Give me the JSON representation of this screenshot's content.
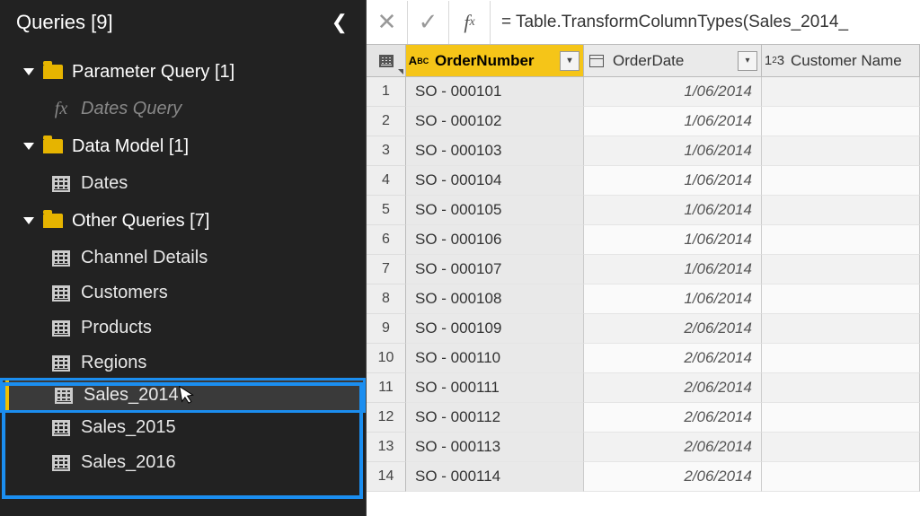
{
  "sidebar": {
    "title": "Queries [9]",
    "groups": [
      {
        "label": "Parameter Query [1]",
        "items": [
          {
            "label": "Dates Query",
            "icon": "fx",
            "dim": true
          }
        ]
      },
      {
        "label": "Data Model [1]",
        "items": [
          {
            "label": "Dates",
            "icon": "table"
          }
        ]
      },
      {
        "label": "Other Queries [7]",
        "items": [
          {
            "label": "Channel Details",
            "icon": "table"
          },
          {
            "label": "Customers",
            "icon": "table"
          },
          {
            "label": "Products",
            "icon": "table"
          },
          {
            "label": "Regions",
            "icon": "table"
          },
          {
            "label": "Sales_2014",
            "icon": "table",
            "selected": true
          },
          {
            "label": "Sales_2015",
            "icon": "table"
          },
          {
            "label": "Sales_2016",
            "icon": "table"
          }
        ]
      }
    ]
  },
  "formula_bar": {
    "value": "= Table.TransformColumnTypes(Sales_2014_"
  },
  "columns": [
    {
      "name": "OrderNumber",
      "type": "ABC",
      "selected": true
    },
    {
      "name": "OrderDate",
      "type": "calendar"
    },
    {
      "name": "Customer Name",
      "type": "123"
    }
  ],
  "rows": [
    {
      "n": 1,
      "order": "SO - 000101",
      "date": "1/06/2014"
    },
    {
      "n": 2,
      "order": "SO - 000102",
      "date": "1/06/2014"
    },
    {
      "n": 3,
      "order": "SO - 000103",
      "date": "1/06/2014"
    },
    {
      "n": 4,
      "order": "SO - 000104",
      "date": "1/06/2014"
    },
    {
      "n": 5,
      "order": "SO - 000105",
      "date": "1/06/2014"
    },
    {
      "n": 6,
      "order": "SO - 000106",
      "date": "1/06/2014"
    },
    {
      "n": 7,
      "order": "SO - 000107",
      "date": "1/06/2014"
    },
    {
      "n": 8,
      "order": "SO - 000108",
      "date": "1/06/2014"
    },
    {
      "n": 9,
      "order": "SO - 000109",
      "date": "2/06/2014"
    },
    {
      "n": 10,
      "order": "SO - 000110",
      "date": "2/06/2014"
    },
    {
      "n": 11,
      "order": "SO - 000111",
      "date": "2/06/2014"
    },
    {
      "n": 12,
      "order": "SO - 000112",
      "date": "2/06/2014"
    },
    {
      "n": 13,
      "order": "SO - 000113",
      "date": "2/06/2014"
    },
    {
      "n": 14,
      "order": "SO - 000114",
      "date": "2/06/2014"
    }
  ]
}
